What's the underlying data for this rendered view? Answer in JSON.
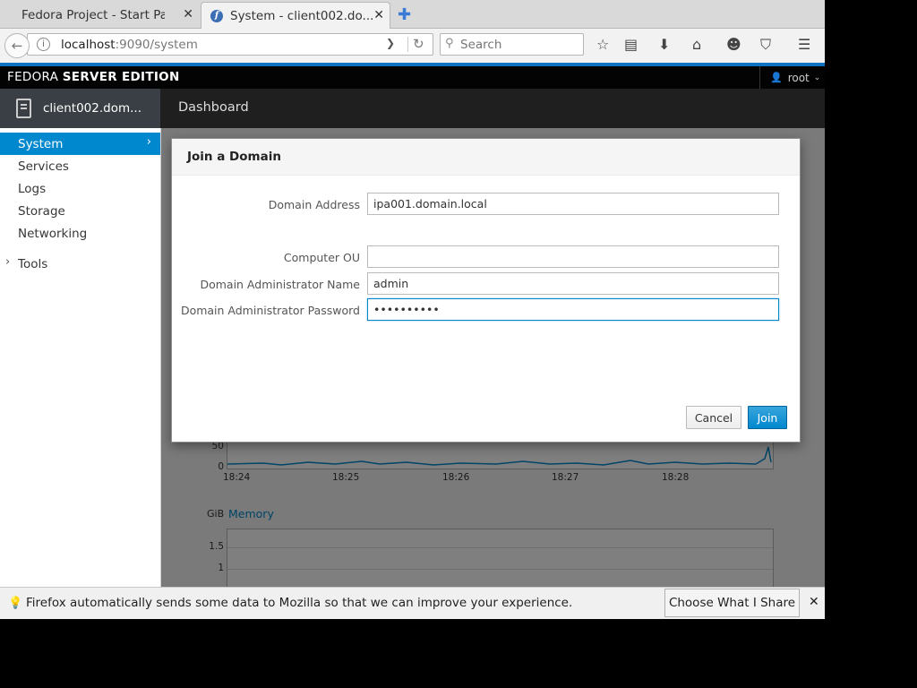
{
  "browser": {
    "tabs": [
      {
        "label": "Fedora Project - Start Pa..."
      },
      {
        "label": "System - client002.do...",
        "favicon": "f"
      }
    ],
    "address": {
      "host": "localhost",
      "path": ":9090/system"
    },
    "search_placeholder": "Search"
  },
  "cockpit": {
    "brand_prefix": "FEDORA",
    "brand_bold": "SERVER EDITION",
    "user": "root",
    "host_name": "client002.dom...",
    "dashboard_label": "Dashboard",
    "nav": [
      {
        "label": "System"
      },
      {
        "label": "Services"
      },
      {
        "label": "Logs"
      },
      {
        "label": "Storage"
      },
      {
        "label": "Networking"
      }
    ],
    "tools_label": "Tools"
  },
  "background_charts": {
    "cpu": {
      "y_ticks": [
        "50",
        "0"
      ],
      "x_ticks": [
        "18:24",
        "18:25",
        "18:26",
        "18:27",
        "18:28"
      ]
    },
    "memory": {
      "unit": "GiB",
      "title": "Memory",
      "y_ticks": [
        "1.5",
        "1"
      ]
    }
  },
  "dialog": {
    "title": "Join a Domain",
    "fields": {
      "domain_address": {
        "label": "Domain Address",
        "value": "ipa001.domain.local"
      },
      "computer_ou": {
        "label": "Computer OU",
        "value": ""
      },
      "admin_name": {
        "label": "Domain Administrator Name",
        "value": "admin"
      },
      "admin_password": {
        "label": "Domain Administrator Password",
        "value": "••••••••••"
      }
    },
    "cancel_label": "Cancel",
    "join_label": "Join"
  },
  "notification": {
    "message": "Firefox automatically sends some data to Mozilla so that we can improve your experience.",
    "button_label": "Choose What I Share"
  },
  "colors": {
    "accent_blue": "#0088ce",
    "header_black": "#030303",
    "firefox_blue_line": "#0f72c0"
  }
}
